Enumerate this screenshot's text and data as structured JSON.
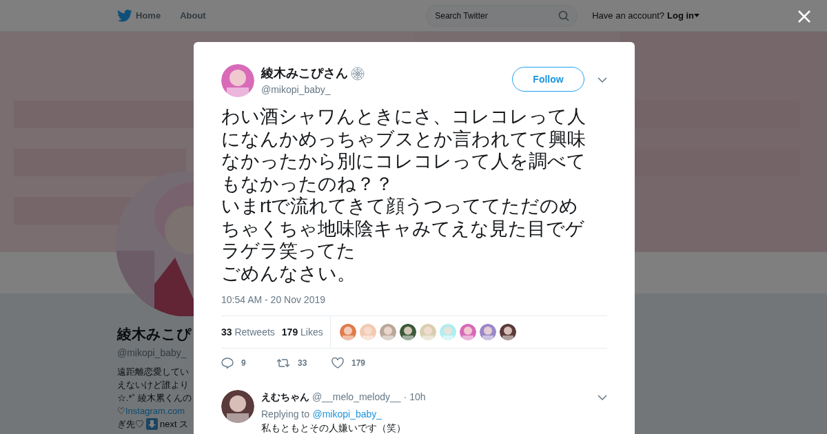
{
  "nav": {
    "items": [
      "Home",
      "About"
    ],
    "search": {
      "placeholder": "Search Twitter"
    },
    "account_prompt": "Have an account?",
    "login": "Log in"
  },
  "profile": {
    "name": "綾木みこぴ",
    "handle": "@mikopi_baby_",
    "bio_lines": [
      {
        "kind": "text",
        "text": "遠距離恋愛してい"
      },
      {
        "kind": "text",
        "text": "えないけど誰より"
      },
      {
        "kind": "text",
        "text": "☆.*˚ 綾木累くんの"
      },
      {
        "kind": "link",
        "prefix": "♡",
        "text": "Instagram.com"
      },
      {
        "kind": "emoji",
        "text": "ぎ先♡",
        "after": "next ス"
      }
    ]
  },
  "tweet": {
    "name": "綾木みこぴさん",
    "handle": "@mikopi_baby_",
    "follow": "Follow",
    "paragraphs": [
      "わい酒シャワんときにさ、コレコレって人になんかめっちゃブスとか言われてて興味なかったから別にコレコレって人を調べてもなかったのね？？",
      "いまrtで流れてきて顔うつっててただのめちゃくちゃ地味陰キャみてえな見た目でゲラゲラ笑ってた",
      "ごめんなさい。"
    ],
    "time": "10:54 AM - 20 Nov 2019",
    "stats": [
      {
        "count": "33",
        "label": "Retweets"
      },
      {
        "count": "179",
        "label": "Likes"
      }
    ],
    "actions": [
      {
        "kind": "reply",
        "count": "9"
      },
      {
        "kind": "retweet",
        "count": "33"
      },
      {
        "kind": "like",
        "count": "179"
      }
    ]
  },
  "reply": {
    "name": "えむちゃん",
    "handle": "@__melo_melody__",
    "time": "· 10h",
    "replying_prefix": "Replying to",
    "replying_to": "@mikopi_baby_",
    "text": "私もともとその人嫌いです（笑）"
  }
}
